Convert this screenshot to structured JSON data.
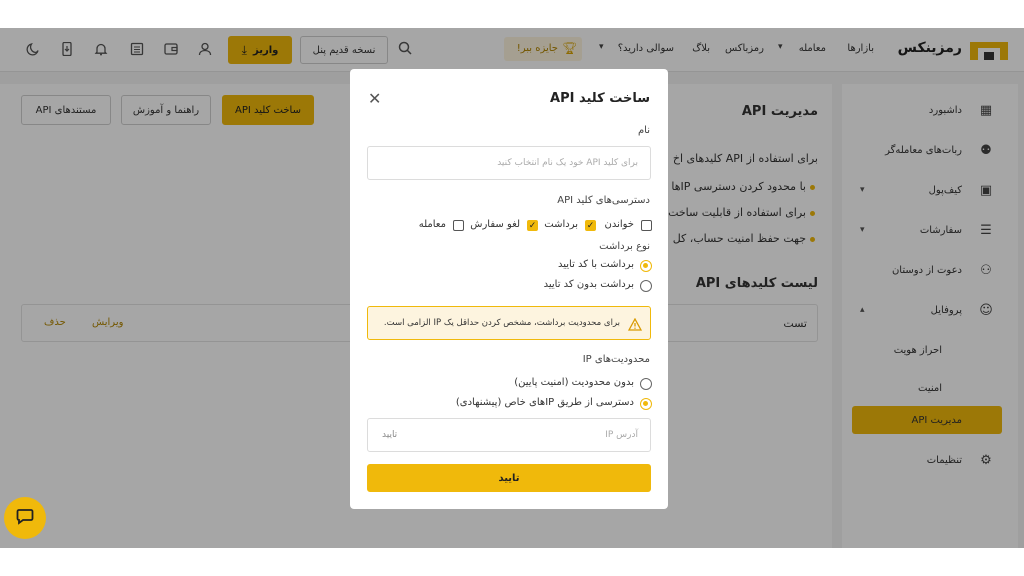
{
  "topbar": {
    "brand": "رمزینکس",
    "nav": [
      {
        "label": "بازارها"
      },
      {
        "label": "معامله"
      },
      {
        "label": "رمزباکس"
      },
      {
        "label": "بلاگ"
      },
      {
        "label": "سوالی دارید؟"
      }
    ],
    "reward_label": "جایزه ببر!",
    "old_panel_label": "نسخه قدیم پنل",
    "deposit_label": "واریز"
  },
  "sidebar": {
    "items": [
      {
        "label": "داشبورد",
        "icon": "grid-icon"
      },
      {
        "label": "ربات‌های معامله‌گر",
        "icon": "robot-icon"
      },
      {
        "label": "کیف‌پول",
        "icon": "wallet-icon"
      },
      {
        "label": "سفارشات",
        "icon": "list-icon"
      },
      {
        "label": "دعوت از دوستان",
        "icon": "user-plus-icon"
      },
      {
        "label": "پروفایل",
        "icon": "user-icon"
      },
      {
        "label": "احراز هویت"
      },
      {
        "label": "امنیت"
      },
      {
        "label": "مدیریت API"
      },
      {
        "label": "تنظیمات",
        "icon": "gear-icon"
      }
    ]
  },
  "main": {
    "title": "مدیریت API",
    "create_button": "ساخت کلید API",
    "guide_button": "راهنما و آموزش",
    "docs_button": "مستندهای API",
    "intro": "برای استفاده از API کلیدهای اخ",
    "bullets": [
      "با محدود کردن دسترسی IPها",
      "برای استفاده از قابلیت ساخت",
      "جهت حفظ امنیت حساب، کل"
    ],
    "list_title": "لیست کلیدهای API",
    "row": {
      "name": "تست",
      "edit": "ویرایش",
      "delete": "حذف"
    }
  },
  "modal": {
    "title": "ساخت کلید API",
    "name_label": "نام",
    "name_placeholder": "برای کلید API خود یک نام انتخاب کنید",
    "permissions_label": "دسترسی‌های کلید API",
    "permissions": [
      {
        "label": "خواندن",
        "checked": false
      },
      {
        "label": "برداشت",
        "checked": true
      },
      {
        "label": "لغو سفارش",
        "checked": true
      },
      {
        "label": "معامله",
        "checked": false
      }
    ],
    "withdraw_type_label": "نوع برداشت",
    "withdraw_options": [
      {
        "label": "برداشت با کد تایید",
        "selected": true
      },
      {
        "label": "برداشت بدون کد تایید",
        "selected": false
      }
    ],
    "warning": "برای محدودیت برداشت، مشخص کردن حداقل یک IP الزامی است.",
    "ip_label": "محدودیت‌های IP",
    "ip_options": [
      {
        "label": "بدون محدودیت (امنیت پایین)",
        "selected": false
      },
      {
        "label": "دسترسی از طریق IPهای خاص (پیشنهادی)",
        "selected": true
      }
    ],
    "ip_placeholder": "آدرس IP",
    "ip_confirm": "تایید",
    "submit": "تایید"
  },
  "colors": {
    "accent": "#f0b90b",
    "warning_bg": "#fdf4df"
  }
}
